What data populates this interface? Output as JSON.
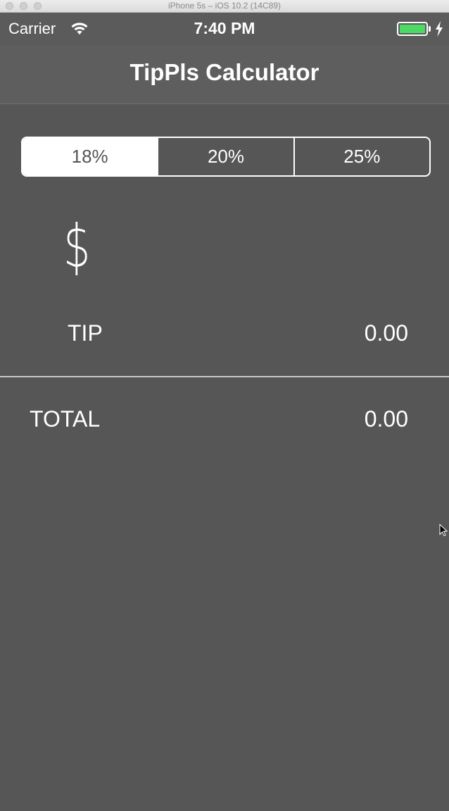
{
  "window": {
    "title": "iPhone 5s – iOS 10.2 (14C89)"
  },
  "status_bar": {
    "carrier": "Carrier",
    "time": "7:40 PM",
    "wifi_icon": "wifi-icon",
    "battery_icon": "battery-icon",
    "charging_icon": "bolt-icon",
    "battery_color": "#4cd964",
    "battery_level": 0.95
  },
  "nav": {
    "title": "TipPls Calculator"
  },
  "tip_selector": {
    "options": [
      "18%",
      "20%",
      "25%"
    ],
    "selected": "18%"
  },
  "bill": {
    "value": "$"
  },
  "tip_row": {
    "label": "TIP",
    "value": "0.00"
  },
  "total_row": {
    "label": "TOTAL",
    "value": "0.00"
  },
  "colors": {
    "background": "#565656",
    "text": "#ffffff",
    "accent": "#ffffff"
  }
}
